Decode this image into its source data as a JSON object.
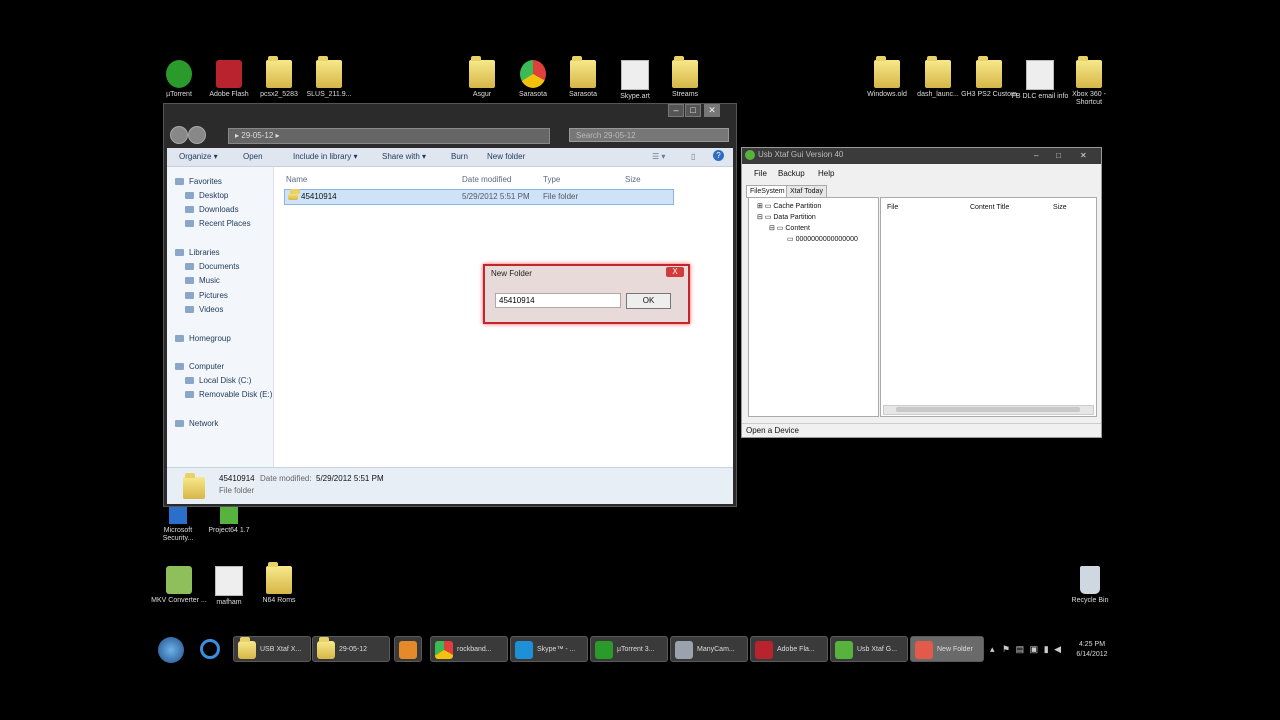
{
  "desktop_icons": [
    {
      "label": "µTorrent",
      "icon": "utorrent-icon",
      "color": "#2a9a2a"
    },
    {
      "label": "Adobe Flash",
      "icon": "adobe-flash-icon",
      "color": "#b8232d"
    },
    {
      "label": "pcsx2_5283",
      "icon": "folder-icon",
      "color": "#e5cc5a"
    },
    {
      "label": "SLUS_211.9...",
      "icon": "folder-icon",
      "color": "#e5cc5a"
    },
    {
      "label": "Asgur",
      "icon": "folder-icon",
      "color": "#e5cc5a"
    },
    {
      "label": "Sarasota",
      "icon": "chrome-icon",
      "color": "#e0403a"
    },
    {
      "label": "Sarasota",
      "icon": "folder-icon",
      "color": "#e5cc5a"
    },
    {
      "label": "Skype.art",
      "icon": "document-icon",
      "color": "#eeeeee"
    },
    {
      "label": "Streams",
      "icon": "folder-icon",
      "color": "#e5cc5a"
    },
    {
      "label": "Windows.old",
      "icon": "folder-icon",
      "color": "#e5cc5a"
    },
    {
      "label": "dash_launc...",
      "icon": "zip-folder-icon",
      "color": "#e5cc5a"
    },
    {
      "label": "GH3 PS2 Custom",
      "icon": "folder-icon",
      "color": "#e5cc5a"
    },
    {
      "label": "FB DLC email info",
      "icon": "document-icon",
      "color": "#eeeeee"
    },
    {
      "label": "Xbox 360 - Shortcut",
      "icon": "folder-icon",
      "color": "#e5cc5a"
    },
    {
      "label": "Microsoft Security...",
      "icon": "shield-icon",
      "color": "#2a6fc9"
    },
    {
      "label": "Project64 1.7",
      "icon": "project64-icon",
      "color": "#58b23e"
    },
    {
      "label": "MKV Converter ...",
      "icon": "mkv-converter-icon",
      "color": "#8fbf5a"
    },
    {
      "label": "mafham",
      "icon": "document-icon",
      "color": "#eeeeee"
    },
    {
      "label": "N64 Roms",
      "icon": "folder-icon",
      "color": "#e5cc5a"
    },
    {
      "label": "Recycle Bin",
      "icon": "recycle-bin-icon",
      "color": "#cfd8e0"
    }
  ],
  "explorer": {
    "address": "▸ 29-05-12 ▸",
    "search_placeholder": "Search 29-05-12",
    "toolbar": [
      "Organize ▾",
      "Open",
      "Include in library ▾",
      "Share with ▾",
      "Burn",
      "New folder"
    ],
    "nav": {
      "favorites": "Favorites",
      "desktop": "Desktop",
      "downloads": "Downloads",
      "recent": "Recent Places",
      "libraries": "Libraries",
      "documents": "Documents",
      "music": "Music",
      "pictures": "Pictures",
      "videos": "Videos",
      "homegroup": "Homegroup",
      "computer": "Computer",
      "local_disk": "Local Disk (C:)",
      "removable": "Removable Disk (E:)",
      "network": "Network"
    },
    "columns": {
      "name": "Name",
      "date": "Date modified",
      "type": "Type",
      "size": "Size"
    },
    "row": {
      "name": "45410914",
      "date": "5/29/2012 5:51 PM",
      "type": "File folder"
    },
    "details": {
      "name": "45410914",
      "date_label": "Date modified:",
      "date": "5/29/2012 5:51 PM",
      "type": "File folder"
    }
  },
  "dialog": {
    "title": "New Folder",
    "value": "45410914",
    "ok": "OK",
    "close": "X"
  },
  "xtaf": {
    "title": "Usb Xtaf Gui Version 40",
    "menu": [
      "File",
      "Backup",
      "Help"
    ],
    "tabs": [
      "FileSystem",
      "Xtaf Today"
    ],
    "tree": [
      "Cache Partition",
      "Data Partition",
      "Content",
      "0000000000000000"
    ],
    "columns": {
      "file": "File",
      "content_title": "Content Title",
      "size": "Size"
    },
    "status": "Open a Device"
  },
  "taskbar": {
    "buttons": [
      {
        "label": "USB Xtaf X...",
        "icon": "folder-icon",
        "color": "#e5cc5a"
      },
      {
        "label": "29-05-12",
        "icon": "folder-icon",
        "color": "#e5cc5a"
      },
      {
        "label": "",
        "icon": "media-icon",
        "color": "#e58a2a"
      },
      {
        "label": "rockband...",
        "icon": "chrome-icon",
        "color": "#e0403a"
      },
      {
        "label": "Skype™ - ...",
        "icon": "skype-icon",
        "color": "#1f8fd6"
      },
      {
        "label": "µTorrent 3...",
        "icon": "utorrent-icon",
        "color": "#2a9a2a"
      },
      {
        "label": "ManyCam...",
        "icon": "manycam-icon",
        "color": "#9aa3ad"
      },
      {
        "label": "Adobe Fla...",
        "icon": "adobe-flash-icon",
        "color": "#b8232d"
      },
      {
        "label": "Usb Xtaf G...",
        "icon": "xbox-icon",
        "color": "#58b23e"
      },
      {
        "label": "New Folder",
        "icon": "window-icon",
        "color": "#e25a4a"
      }
    ],
    "time": "4:25 PM",
    "date": "6/14/2012"
  }
}
